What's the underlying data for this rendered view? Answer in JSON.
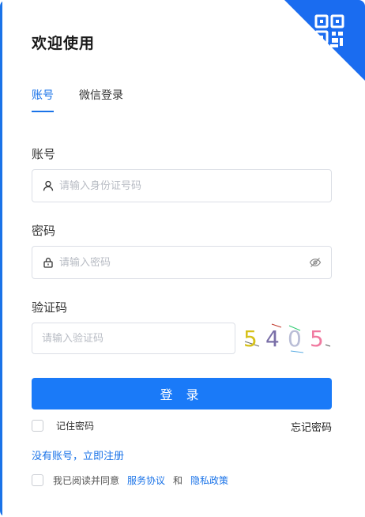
{
  "title": "欢迎使用",
  "tabs": [
    {
      "label": "账号",
      "active": true
    },
    {
      "label": "微信登录",
      "active": false
    }
  ],
  "account": {
    "label": "账号",
    "placeholder": "请输入身份证号码",
    "value": ""
  },
  "password": {
    "label": "密码",
    "placeholder": "请输入密码",
    "value": ""
  },
  "captcha": {
    "label": "验证码",
    "placeholder": "请输入验证码",
    "value": "",
    "code": [
      "5",
      "4",
      "0",
      "5"
    ]
  },
  "login_button": "登 录",
  "remember_label": "记住密码",
  "forgot_link": "忘记密码",
  "register_link": "没有账号，立即注册",
  "agreement": {
    "prefix": "我已阅读并同意",
    "service_link": "服务协议",
    "and": "和",
    "privacy_link": "隐私政策"
  },
  "colors": {
    "accent": "#1a73e8",
    "button": "#1a7af8",
    "border": "#dcdfe6",
    "placeholder": "#b8bcc4"
  },
  "icons": {
    "corner": "qr-code-icon",
    "account": "user-icon",
    "password": "lock-icon",
    "toggle": "eye-slash-icon"
  }
}
